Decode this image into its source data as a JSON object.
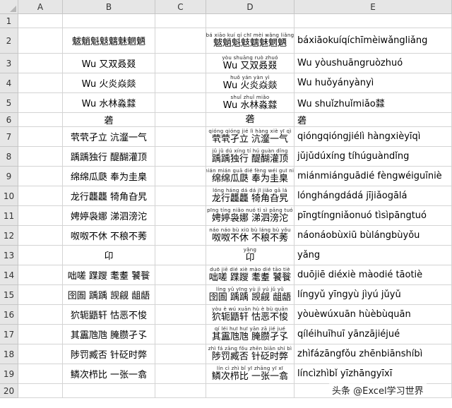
{
  "columns": [
    "A",
    "B",
    "C",
    "D",
    "E"
  ],
  "rows": [
    {
      "num": "1",
      "b": "",
      "d_py": "",
      "d_hz": "",
      "e": ""
    },
    {
      "num": "2",
      "b": "魃魈魁鬾魑魅魍魉",
      "d_py": "bá xiāo kuí qí chī mèi wǎng liǎng",
      "d_hz": "魃魈魁鬾魑魅魍魉",
      "e": "báxiāokuíqíchīmèiwǎngliǎng"
    },
    {
      "num": "3",
      "b": "Wu 又双叒叕",
      "d_py": "yòu shuāng ruò zhuó",
      "d_hz": "Wu 又双叒叕",
      "e": "Wu yòushuāngruòzhuó"
    },
    {
      "num": "4",
      "b": "Wu 火炎焱燚",
      "d_py": "huǒ yán yàn yì",
      "d_hz": "Wu 火炎焱燚",
      "e": "Wu huǒyányànyì"
    },
    {
      "num": "5",
      "b": "Wu 水林淼㵘",
      "d_py": "shuǐ zhuǐ miǎo",
      "d_hz": "Wu 水林淼㵘",
      "e": "Wu shuǐzhuǐmiǎo㵘"
    },
    {
      "num": "6",
      "b": "砻",
      "d_py": "",
      "d_hz": "砻",
      "e": "砻"
    },
    {
      "num": "7",
      "b": "茕茕孑立 沆瀣一气",
      "d_py": "qióng qióng jié lì  hàng xiè yī qì",
      "d_hz": "茕茕孑立 沆瀣一气",
      "e": "qióngqióngjiélì hàngxièyīqì"
    },
    {
      "num": "8",
      "b": "踽踽独行 醍醐灌顶",
      "d_py": "jǔ jǔ dú xíng  tí hú guàn dǐng",
      "d_hz": "踽踽独行 醍醐灌顶",
      "e": "jǔjǔdúxíng tíhúguàndǐng"
    },
    {
      "num": "9",
      "b": "绵绵瓜瓞 奉为圭臬",
      "d_py": "mián mián guā dié  fèng wéi guī niè",
      "d_hz": "绵绵瓜瓞 奉为圭臬",
      "e": "miánmiánguādié fèngwéiguīniè"
    },
    {
      "num": "10",
      "b": "龙行龘龘 犄角旮旯",
      "d_py": "lóng háng dá dá  jī jiǎo gā lá",
      "d_hz": "龙行龘龘 犄角旮旯",
      "e": "lónghángdádá jījiǎogālá"
    },
    {
      "num": "11",
      "b": "娉婷袅娜 涕泗滂沱",
      "d_py": "pīng tíng niǎo nuó  tì sì pāng tuó",
      "d_hz": "娉婷袅娜 涕泗滂沱",
      "e": "pīngtíngniǎonuó tìsìpāngtuó"
    },
    {
      "num": "12",
      "b": "呶呶不休 不稂不莠",
      "d_py": "náo náo bù xiū  bù láng bù yǒu",
      "d_hz": "呶呶不休 不稂不莠",
      "e": "náonáobùxiū bùlángbùyǒu"
    },
    {
      "num": "13",
      "b": "卬",
      "d_py": "yǎng",
      "d_hz": "卬",
      "e": "yǎng"
    },
    {
      "num": "14",
      "b": "咄嗟 蹀躞 耄耋 饕餮",
      "d_py": "duō jiē  dié xiè  mào dié  tāo tiè",
      "d_hz": "咄嗟 蹀躞 耄耋 饕餮",
      "e": "duōjiē diéxiè màodié tāotiè"
    },
    {
      "num": "15",
      "b": "囹圄 踽踽 觊觎 龃龉",
      "d_py": "líng yǔ  yīng yù  jì yú  jǔ yǔ",
      "d_hz": "囹圄 踽踽 觊觎 龃龉",
      "e": "língyǔ yīngyù jìyú jǔyǔ"
    },
    {
      "num": "16",
      "b": "狖轭鼯轩 怙恶不悛",
      "d_py": "yòu è wú xuān  hù è bù quān",
      "d_hz": "狖轭鼯轩 怙恶不悛",
      "e": "yòuèwúxuān hùèbùquān"
    },
    {
      "num": "17",
      "b": "其靁虺虺 腌臜孑孓",
      "d_py": "qí léi huī huī  yān zā jié jué",
      "d_hz": "其靁虺虺 腌臜孑孓",
      "e": "qíléihuīhuī yānzājiéjué"
    },
    {
      "num": "18",
      "b": "陟罚臧否 针砭时弊",
      "d_py": "zhì fá zāng fǒu  zhēn biān shí bì",
      "d_hz": "陟罚臧否 针砭时弊",
      "e": "zhìfázāngfǒu zhēnbiānshíbì"
    },
    {
      "num": "19",
      "b": "鳞次栉比 一张一翕",
      "d_py": "lín cì zhì bǐ  yī zhāng yī xī",
      "d_hz": "鳞次栉比 一张一翕",
      "e": "líncìzhìbǐ yīzhāngyīxī"
    },
    {
      "num": "20",
      "b": "",
      "d_py": "",
      "d_hz": "",
      "e": ""
    }
  ],
  "watermark": "头条 @Excel学习世界"
}
